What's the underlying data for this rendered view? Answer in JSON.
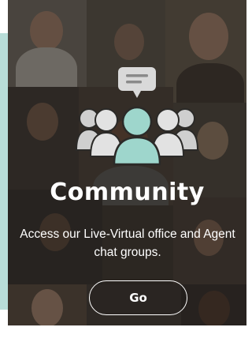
{
  "card": {
    "title": "Community",
    "description": "Access our Live-Virtual office and Agent chat groups.",
    "go_label": "Go"
  },
  "icons": {
    "chat": "chat-bubble-icon",
    "people": "people-group-icon"
  },
  "colors": {
    "teal_accent": "#b8ddd8",
    "people_highlight": "#9ed6cc",
    "people_muted": "#d7d7d7",
    "overlay": "#141210",
    "text": "#ffffff"
  }
}
